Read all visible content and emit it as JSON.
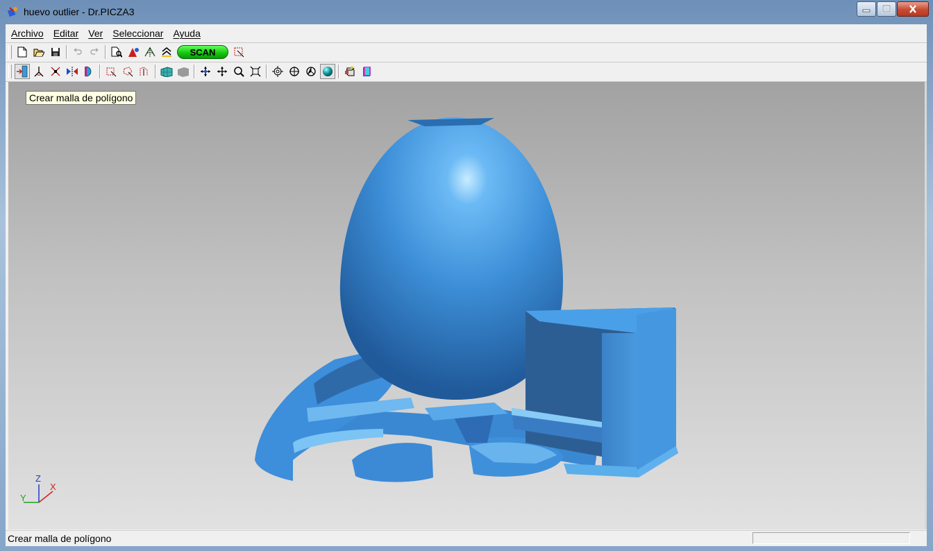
{
  "window": {
    "title": "huevo outlier - Dr.PICZA3"
  },
  "menu": {
    "items": [
      "Archivo",
      "Editar",
      "Ver",
      "Seleccionar",
      "Ayuda"
    ]
  },
  "toolbar": {
    "scan_label": "SCAN",
    "row1_icons": [
      "new-file-icon",
      "open-folder-icon",
      "save-icon",
      "undo-icon",
      "redo-icon",
      "print-preview-icon",
      "texture-icon",
      "align-icon",
      "surface-icon",
      "scan-button",
      "select-region-icon"
    ],
    "row2_icons": [
      "create-mesh-icon",
      "angle-icon",
      "cut-icon",
      "mirror-icon",
      "section-icon",
      "select-rect-icon",
      "select-lasso-icon",
      "select-points-icon",
      "wireframe-icon",
      "flat-surface-icon",
      "pan-icon",
      "move-icon",
      "zoom-icon",
      "fit-icon",
      "target-icon",
      "rotate-icon",
      "center-icon",
      "sphere-shade-icon",
      "cube-view-icon",
      "color-view-icon"
    ]
  },
  "viewport": {
    "tooltip": "Crear malla de polígono",
    "axes": {
      "z": "Z",
      "y": "Y",
      "x": "X"
    },
    "colors": {
      "model": "#3f94e0",
      "background_top": "#a2a2a2",
      "background_bottom": "#e1e1e1"
    }
  },
  "status": {
    "text": "Crear malla de polígono"
  }
}
